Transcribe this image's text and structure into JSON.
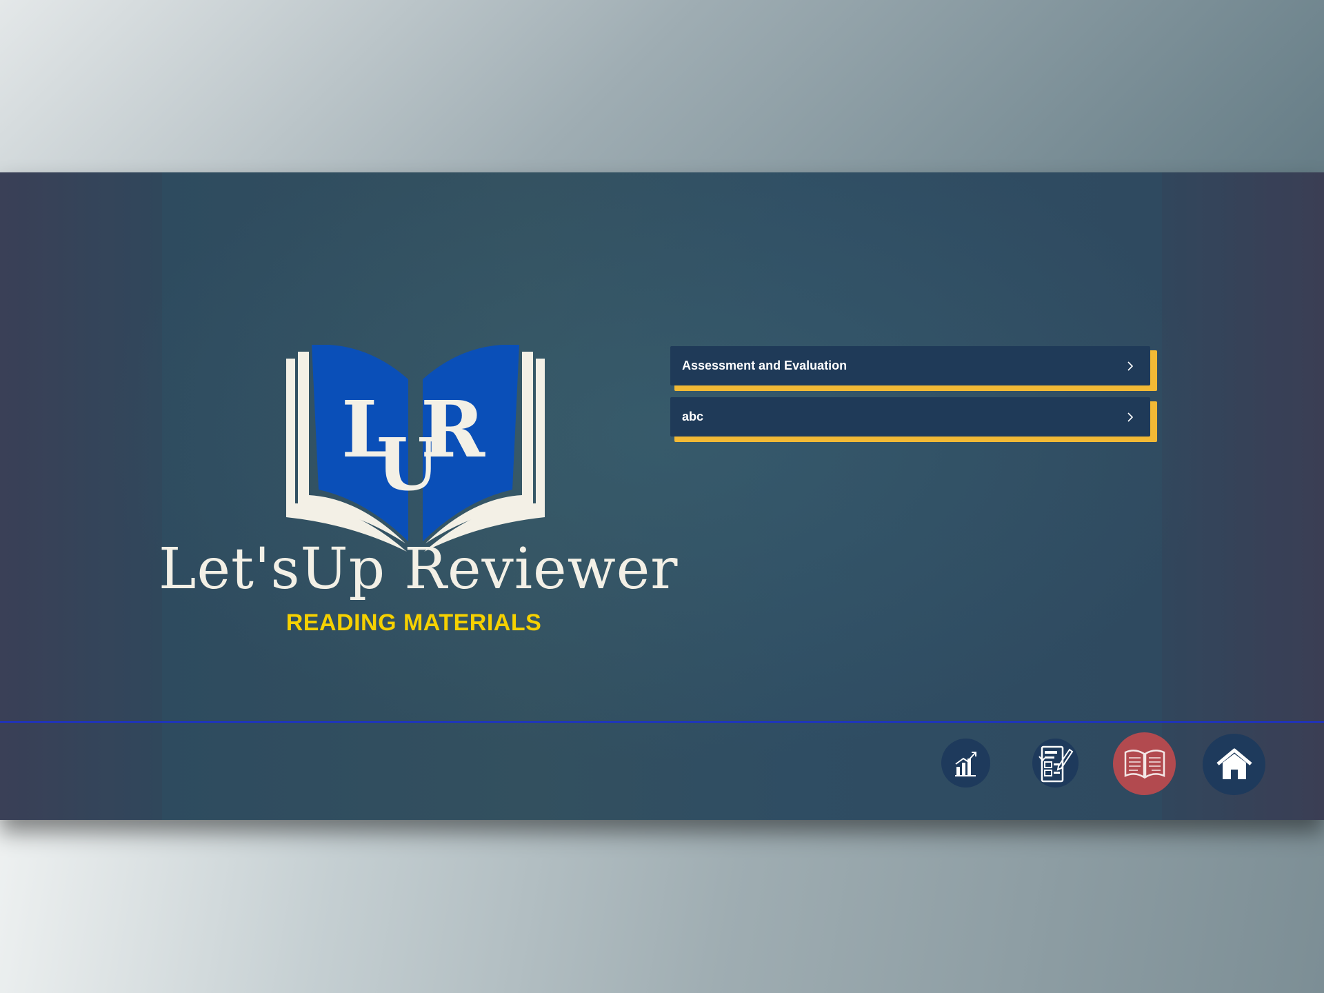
{
  "app": {
    "brand_name": "Let'sUp Reviewer",
    "logo_letters": "LUR",
    "section_title": "READING MATERIALS"
  },
  "materials": [
    {
      "label": "Assessment and Evaluation",
      "icon": "chevron-right-icon"
    },
    {
      "label": "abc",
      "icon": "chevron-right-icon"
    }
  ],
  "nav": [
    {
      "id": "stats",
      "icon": "bar-chart-growth-icon",
      "active": false
    },
    {
      "id": "quiz",
      "icon": "exam-checklist-icon",
      "active": false
    },
    {
      "id": "reading",
      "icon": "open-book-icon",
      "active": true
    },
    {
      "id": "home",
      "icon": "home-icon",
      "active": false
    }
  ],
  "colors": {
    "panel": "#1f3a58",
    "accent": "#f2b935",
    "subtitle": "#f6d100",
    "active_nav": "#b24a4f",
    "nav": "#1e3a5c",
    "logo_blue": "#0a4fb8"
  }
}
